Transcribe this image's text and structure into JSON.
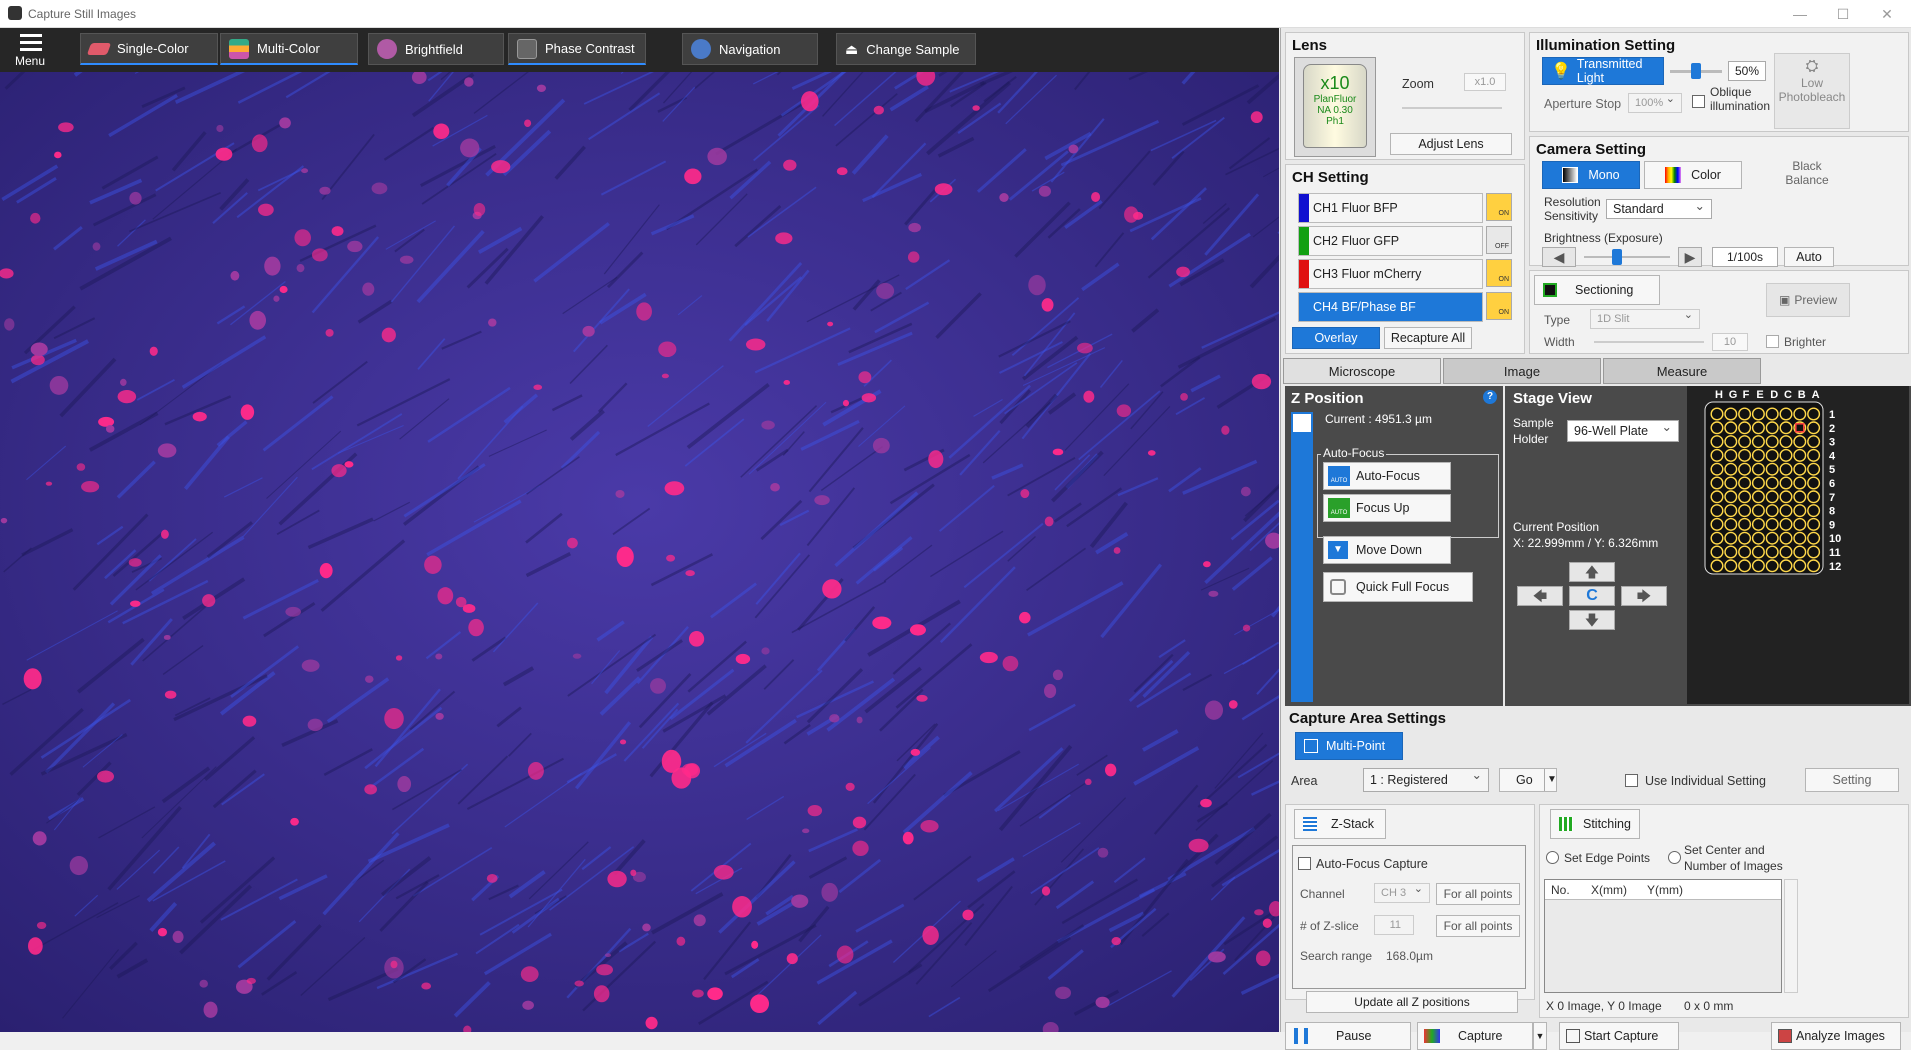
{
  "window": {
    "title": "Capture Still Images"
  },
  "toolbar": {
    "menu_label": "Menu",
    "single_color": "Single-Color",
    "multi_color": "Multi-Color",
    "brightfield": "Brightfield",
    "phase_contrast": "Phase Contrast",
    "navigation": "Navigation",
    "change_sample": "Change Sample"
  },
  "lens": {
    "title": "Lens",
    "mag": "x10",
    "name": "PlanFluor",
    "na": "NA 0.30",
    "ph": "Ph1",
    "zoom_label": "Zoom",
    "zoom_value": "x1.0",
    "adjust": "Adjust Lens"
  },
  "illumination": {
    "title": "Illumination Setting",
    "transmitted": "Transmitted Light",
    "percent": "50%",
    "aperture_label": "Aperture Stop",
    "aperture_value": "100%",
    "oblique_1": "Oblique",
    "oblique_2": "illumination",
    "low_1": "Low",
    "low_2": "Photobleach",
    "slider_level": 0.5
  },
  "ch_setting": {
    "title": "CH Setting",
    "channels": [
      {
        "label": "CH1 Fluor BFP",
        "color": "#1010d0",
        "state": "ON"
      },
      {
        "label": "CH2 Fluor GFP",
        "color": "#11a011",
        "state": "OFF"
      },
      {
        "label": "CH3 Fluor mCherry",
        "color": "#e01010",
        "state": "ON"
      },
      {
        "label": "CH4 BF/Phase BF",
        "color": "#1e78d8",
        "state": "ON"
      }
    ],
    "overlay": "Overlay",
    "recapture": "Recapture All"
  },
  "camera": {
    "title": "Camera Setting",
    "mono": "Mono",
    "color": "Color",
    "black_1": "Black",
    "black_2": "Balance",
    "res_1": "Resolution",
    "res_2": "Sensitivity",
    "res_value": "Standard",
    "brightness": "Brightness (Exposure)",
    "exposure": "1/100s",
    "auto": "Auto"
  },
  "sectioning": {
    "btn": "Sectioning",
    "preview": "Preview",
    "type_label": "Type",
    "type_value": "1D Slit",
    "width_label": "Width",
    "width_value": "10",
    "brighter": "Brighter"
  },
  "tabs": [
    "Microscope",
    "Image",
    "Measure"
  ],
  "zpos": {
    "title": "Z Position",
    "current": "Current : 4951.3 µm",
    "af_group": "Auto-Focus",
    "autofocus": "Auto-Focus",
    "focus_up": "Focus Up",
    "move_down": "Move Down",
    "quick_full": "Quick Full Focus",
    "auto_tag": "AUTO"
  },
  "stage": {
    "title": "Stage View",
    "holder_1": "Sample",
    "holder_2": "Holder",
    "holder_value": "96-Well Plate",
    "cp_label": "Current Position",
    "cp_value": "X: 22.999mm / Y: 6.326mm",
    "center": "C",
    "cols": [
      "H",
      "G",
      "F",
      "E",
      "D",
      "C",
      "B",
      "A"
    ],
    "rows": [
      "1",
      "2",
      "3",
      "4",
      "5",
      "6",
      "7",
      "8",
      "9",
      "10",
      "11",
      "12"
    ]
  },
  "capture_area": {
    "title": "Capture Area Settings",
    "multipoint": "Multi-Point",
    "area_label": "Area",
    "area_value": "1 : Registered",
    "go": "Go",
    "use_individual": "Use Individual Setting",
    "setting": "Setting"
  },
  "zstack": {
    "btn": "Z-Stack",
    "af_capture": "Auto-Focus Capture",
    "channel_label": "Channel",
    "channel_value": "CH 3",
    "for_all_1": "For all points",
    "zslice_label": "# of Z-slice",
    "zslice_value": "11",
    "for_all_2": "For all points",
    "search_label": "Search range",
    "search_value": "168.0µm",
    "update": "Update all Z positions"
  },
  "stitching": {
    "btn": "Stitching",
    "edge": "Set Edge Points",
    "center_1": "Set Center and",
    "center_2": "Number of Images",
    "col_no": "No.",
    "col_x": "X(mm)",
    "col_y": "Y(mm)",
    "footer_images": "X 0 Image, Y 0 Image",
    "footer_size": "0 x 0 mm"
  },
  "bottom": {
    "pause": "Pause",
    "capture": "Capture",
    "start": "Start Capture",
    "analyze": "Analyze Images"
  },
  "colors": {
    "accent": "#1e78d8",
    "toolbar": "#262626"
  }
}
